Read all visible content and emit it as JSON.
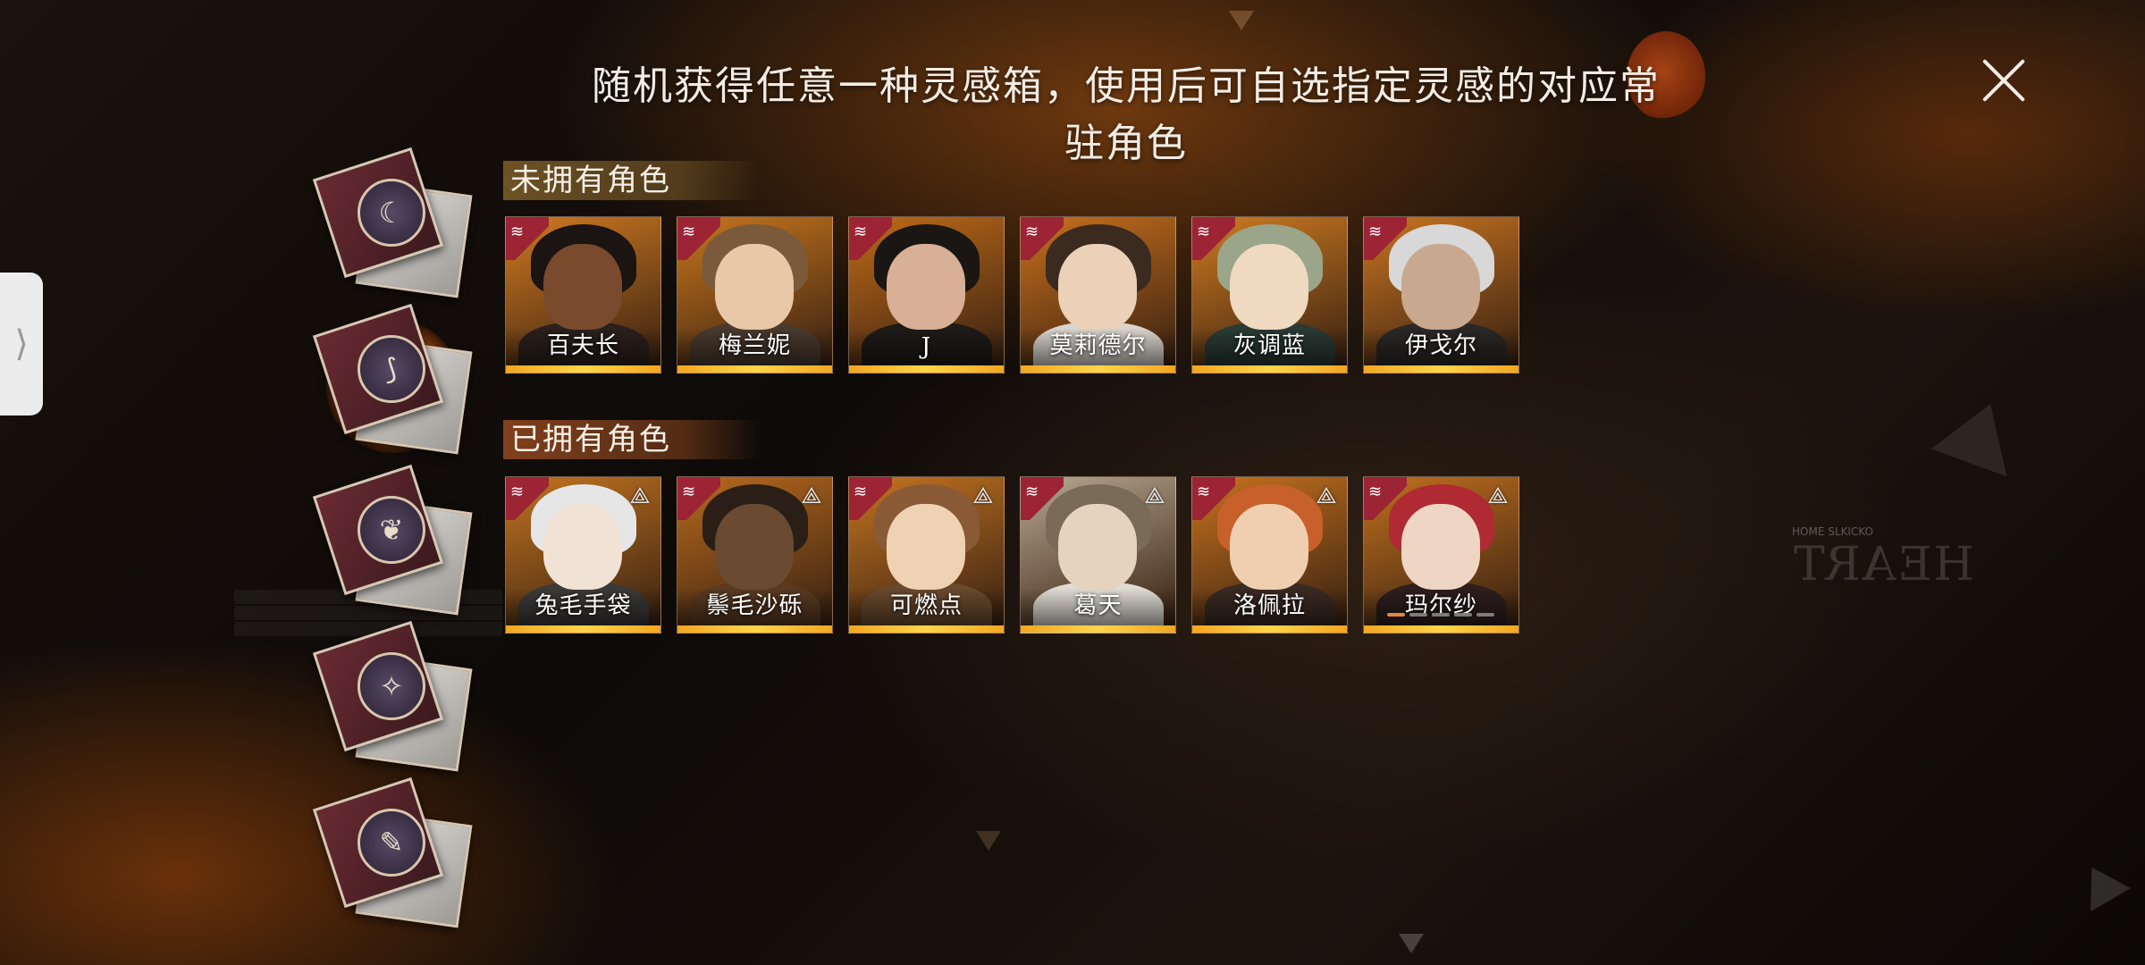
{
  "header": {
    "title": "随机获得任意一种灵感箱，使用后可自选指定灵感的对应常驻角色",
    "close_icon": "close-icon"
  },
  "side_tab": {
    "icon": "chevron-right-icon",
    "glyph": "⟩"
  },
  "boxes": [
    {
      "icon": "moon-pyramid-icon",
      "glyph": "☾",
      "selected": false
    },
    {
      "icon": "claw-icon",
      "glyph": "⟆",
      "selected": true
    },
    {
      "icon": "leaf-icon",
      "glyph": "❦",
      "selected": false
    },
    {
      "icon": "star-icon",
      "glyph": "✧",
      "selected": false
    },
    {
      "icon": "tools-icon",
      "glyph": "✎",
      "selected": false
    }
  ],
  "sections": {
    "not_owned": {
      "title": "未拥有角色",
      "characters": [
        {
          "name": "百夫长",
          "skin": "#7a4a2e",
          "hair": "#1a1412",
          "body": "#2a201c",
          "bg": "#d07a20"
        },
        {
          "name": "梅兰妮",
          "skin": "#e8c8a6",
          "hair": "#7a5a3a",
          "body": "#4a3a2e",
          "bg": "#c8761c"
        },
        {
          "name": "J",
          "skin": "#d8b096",
          "hair": "#1a1614",
          "body": "#1e1a18",
          "bg": "#c06b18"
        },
        {
          "name": "莫莉德尔",
          "skin": "#ead1b8",
          "hair": "#3a2a20",
          "body": "#d9d4cc",
          "bg": "#c8701c"
        },
        {
          "name": "灰调蓝",
          "skin": "#efd9c0",
          "hair": "#9aa58a",
          "body": "#2a3a34",
          "bg": "#cf7b20"
        },
        {
          "name": "伊戈尔",
          "skin": "#c9a890",
          "hair": "#d8d8d8",
          "body": "#2a2826",
          "bg": "#c87420"
        }
      ]
    },
    "owned": {
      "title": "已拥有角色",
      "owned_icon": "triangle-rank-icon",
      "owned_glyph": "⟁",
      "characters": [
        {
          "name": "兔毛手袋",
          "skin": "#f0e2d4",
          "hair": "#e6e6e6",
          "body": "#3c3a38",
          "bg": "#c27420"
        },
        {
          "name": "鬃毛沙砾",
          "skin": "#6a4a30",
          "hair": "#2a1e16",
          "body": "#5a3a22",
          "bg": "#b86a1c"
        },
        {
          "name": "可燃点",
          "skin": "#efd2b4",
          "hair": "#8a5a36",
          "body": "#6a4a2e",
          "bg": "#c47420"
        },
        {
          "name": "葛天",
          "skin": "#e6d3be",
          "hair": "#7a6a58",
          "body": "#e0dcd4",
          "bg": "#b8a890"
        },
        {
          "name": "洛佩拉",
          "skin": "#efcfb0",
          "hair": "#c7602a",
          "body": "#3a2a22",
          "bg": "#c6721e"
        },
        {
          "name": "玛尔纱",
          "skin": "#efd6c4",
          "hair": "#b02a34",
          "body": "#2e1e1e",
          "bg": "#c0701e",
          "pips": [
            1,
            0,
            0,
            0,
            0
          ]
        }
      ]
    }
  },
  "watermark": {
    "small": "HOME SLKICKO",
    "logo": "HEART"
  }
}
